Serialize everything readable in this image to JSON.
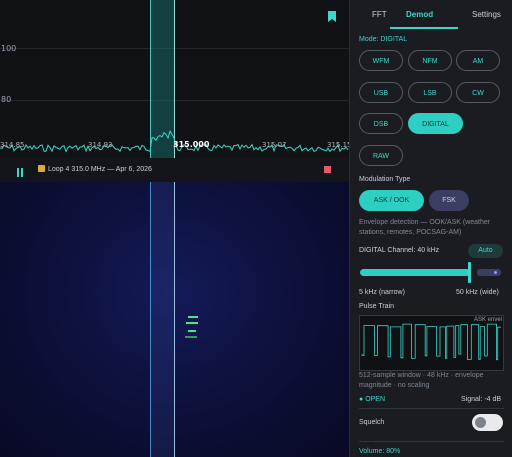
{
  "spectrum": {
    "y_labels": [
      "100",
      "80"
    ],
    "freq_labels": [
      "314.85",
      "314.93",
      "315.000",
      "315.07",
      "315.15"
    ]
  },
  "player": {
    "recording_title": "Loop 4 315.0 MHz — Apr 6, 2026",
    "pause_icon": "pause-icon",
    "stop_icon": "stop-icon",
    "bookmark_icon": "bookmark-icon"
  },
  "tabs": [
    {
      "label": "FFT"
    },
    {
      "label": "Demod"
    },
    {
      "label": "Settings"
    }
  ],
  "active_tab": "Demod",
  "mode": {
    "title": "Mode: DIGITAL",
    "buttons": [
      {
        "label": "WFM"
      },
      {
        "label": "NFM"
      },
      {
        "label": "AM"
      },
      {
        "label": "USB"
      },
      {
        "label": "LSB"
      },
      {
        "label": "CW"
      },
      {
        "label": "DSB"
      },
      {
        "label": "DIGITAL"
      },
      {
        "label": "RAW"
      }
    ],
    "selected": "DIGITAL"
  },
  "modulation": {
    "title": "Modulation Type",
    "options": [
      {
        "label": "ASK / OOK"
      },
      {
        "label": "FSK"
      }
    ],
    "selected": "ASK / OOK",
    "description": "Envelope detection — OOK/ASK (weather stations, remotes, POCSAG-AM)"
  },
  "channel": {
    "label": "DIGITAL Channel: 40 kHz",
    "auto_label": "Auto",
    "min_label": "5 kHz (narrow)",
    "max_label": "50 kHz (wide)",
    "value_khz": 40,
    "min_khz": 5,
    "max_khz": 50
  },
  "pulse": {
    "title": "Pulse Train",
    "tag": "ASK envel",
    "caption": "512-sample window · 48 kHz · envelope magnitude · no scaling"
  },
  "status": {
    "open_label": "OPEN",
    "signal_label": "Signal: -4 dB"
  },
  "squelch": {
    "label": "Squelch",
    "enabled": false
  },
  "volume": {
    "label": "Volume: 80%",
    "value_percent": 80
  },
  "colors": {
    "accent": "#3dd6c8",
    "stop": "#e25a62",
    "waterfall_bg": "#0e1240"
  }
}
